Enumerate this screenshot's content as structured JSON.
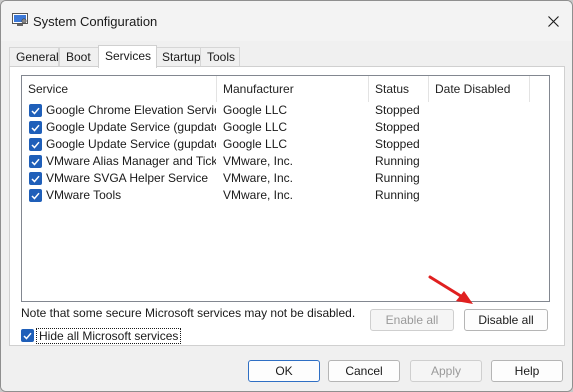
{
  "window": {
    "title": "System Configuration",
    "icon": "system-config-icon",
    "close_icon": "close-icon"
  },
  "tabs": [
    {
      "label": "General",
      "active": false
    },
    {
      "label": "Boot",
      "active": false
    },
    {
      "label": "Services",
      "active": true
    },
    {
      "label": "Startup",
      "active": false
    },
    {
      "label": "Tools",
      "active": false
    }
  ],
  "services": {
    "columns": [
      "Service",
      "Manufacturer",
      "Status",
      "Date Disabled"
    ],
    "rows": [
      {
        "checked": true,
        "service": "Google Chrome Elevation Servic...",
        "manufacturer": "Google LLC",
        "status": "Stopped",
        "date_disabled": ""
      },
      {
        "checked": true,
        "service": "Google Update Service (gupdate)",
        "manufacturer": "Google LLC",
        "status": "Stopped",
        "date_disabled": ""
      },
      {
        "checked": true,
        "service": "Google Update Service (gupdatem)",
        "manufacturer": "Google LLC",
        "status": "Stopped",
        "date_disabled": ""
      },
      {
        "checked": true,
        "service": "VMware Alias Manager and Ticke...",
        "manufacturer": "VMware, Inc.",
        "status": "Running",
        "date_disabled": ""
      },
      {
        "checked": true,
        "service": "VMware SVGA Helper Service",
        "manufacturer": "VMware, Inc.",
        "status": "Running",
        "date_disabled": ""
      },
      {
        "checked": true,
        "service": "VMware Tools",
        "manufacturer": "VMware, Inc.",
        "status": "Running",
        "date_disabled": ""
      }
    ],
    "note": "Note that some secure Microsoft services may not be disabled.",
    "enable_all_label": "Enable all",
    "disable_all_label": "Disable all",
    "hide_ms": {
      "checked": true,
      "label": "Hide all Microsoft services"
    }
  },
  "footer": {
    "ok_label": "OK",
    "cancel_label": "Cancel",
    "apply_label": "Apply",
    "help_label": "Help"
  },
  "colors": {
    "checkbox": "#1f5fb9",
    "annotation_arrow": "#e02020",
    "window_bg": "#f0f0f0"
  }
}
